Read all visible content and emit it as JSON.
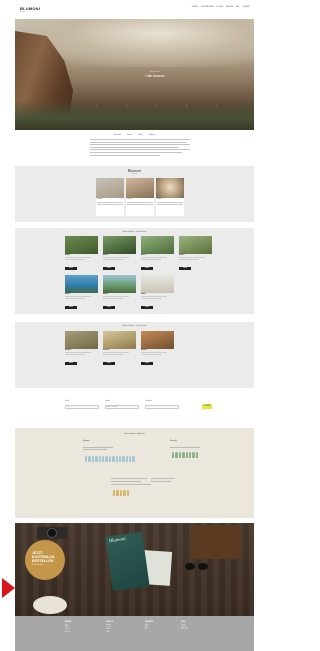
{
  "header": {
    "logo": "BLUMONI",
    "tagline": "Reisen",
    "nav": [
      "REISEN",
      "DESTINATIONEN",
      "HOTELS",
      "MAGAZIN",
      "ABO",
      "KONTAKT"
    ]
  },
  "hero": {
    "kicker": "Myanmar",
    "title": "Little treasure"
  },
  "subnav": [
    "Übersicht",
    "Reisen",
    "Hotels",
    "Magazin"
  ],
  "reisen": {
    "brand": "Blumoni",
    "brand_sub": "Reisen",
    "cards": [
      "Reise 1",
      "Reise 2",
      "Reise 3"
    ]
  },
  "hotels": {
    "heading": "Beste Hotels – zum Buchen",
    "items": [
      {
        "name": "Hotel 1",
        "btn": "MEHR"
      },
      {
        "name": "Hotel 2",
        "btn": "MEHR"
      },
      {
        "name": "Hotel 3",
        "btn": "MEHR"
      },
      {
        "name": "Hotel 4",
        "btn": "MEHR"
      },
      {
        "name": "Hotel 5",
        "btn": "MEHR"
      },
      {
        "name": "Hotel 6",
        "btn": "MEHR"
      },
      {
        "name": "Hotel 7",
        "btn": "MEHR"
      }
    ]
  },
  "resorts": {
    "heading": "Beste Resorts – zum Buchen",
    "items": [
      {
        "name": "Resort 1",
        "btn": "MEHR"
      },
      {
        "name": "Resort 2",
        "btn": "MEHR"
      },
      {
        "name": "Resort 3",
        "btn": "MEHR"
      }
    ]
  },
  "search": {
    "labels": [
      "Reise",
      "Datum",
      "Personen"
    ],
    "placeholders": [
      "Ziel",
      "Anreise – Abreise",
      "2"
    ],
    "button": "SUCHEN",
    "button_sub": "Alle Reisen"
  },
  "infographic": {
    "heading": "Reisezahlen in Myanmar",
    "cols": [
      "Myanmar",
      "Reisende"
    ]
  },
  "magazine": {
    "badge": "JETZT KOSTENLOS BESTELLEN",
    "badge_sub": "Das Reisemagazin",
    "cover_title": "Blumoni"
  },
  "footer": {
    "cols": [
      {
        "title": "REISEN",
        "links": [
          "Asien",
          "Afrika",
          "Europa",
          "Amerika"
        ]
      },
      {
        "title": "HOTELS",
        "links": [
          "Boutique",
          "Resorts",
          "Lodges",
          "Städte"
        ]
      },
      {
        "title": "MAGAZIN",
        "links": [
          "Artikel",
          "Archiv",
          "Abo"
        ]
      },
      {
        "title": "INFO",
        "links": [
          "Kontakt",
          "Impressum",
          "Datenschutz"
        ]
      }
    ]
  },
  "colors": {
    "accent_yellow": "#e8e74a",
    "arrow_red": "#d7151a",
    "badge_gold": "#c4964a",
    "footer_grey": "#a7a7a7"
  }
}
